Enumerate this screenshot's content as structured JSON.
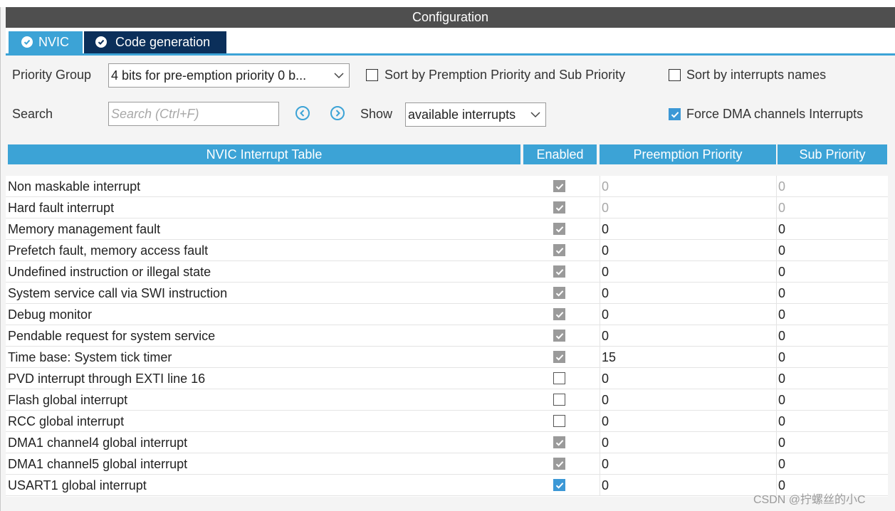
{
  "header": {
    "title": "Configuration"
  },
  "tabs": [
    {
      "label": "NVIC",
      "active": true
    },
    {
      "label": "Code generation",
      "active": false
    }
  ],
  "controls": {
    "priority_group_label": "Priority Group",
    "priority_group_value": "4 bits for pre-emption priority 0 b...",
    "sort_premption_label": "Sort by Premption Priority and Sub Priority",
    "sort_premption_checked": false,
    "sort_names_label": "Sort by interrupts names",
    "sort_names_checked": false,
    "search_label": "Search",
    "search_placeholder": "Search (Ctrl+F)",
    "search_value": "",
    "show_label": "Show",
    "show_value": "available interrupts",
    "force_dma_label": "Force DMA channels Interrupts",
    "force_dma_checked": true
  },
  "table": {
    "headers": [
      "NVIC Interrupt Table",
      "Enabled",
      "Preemption Priority",
      "Sub Priority"
    ],
    "rows": [
      {
        "name": "Non maskable interrupt",
        "enabled": "locked",
        "preemption": "0",
        "sub": "0",
        "editable": false
      },
      {
        "name": "Hard fault interrupt",
        "enabled": "locked",
        "preemption": "0",
        "sub": "0",
        "editable": false
      },
      {
        "name": "Memory management fault",
        "enabled": "locked",
        "preemption": "0",
        "sub": "0",
        "editable": true
      },
      {
        "name": "Prefetch fault, memory access fault",
        "enabled": "locked",
        "preemption": "0",
        "sub": "0",
        "editable": true
      },
      {
        "name": "Undefined instruction or illegal state",
        "enabled": "locked",
        "preemption": "0",
        "sub": "0",
        "editable": true
      },
      {
        "name": "System service call via SWI instruction",
        "enabled": "locked",
        "preemption": "0",
        "sub": "0",
        "editable": true
      },
      {
        "name": "Debug monitor",
        "enabled": "locked",
        "preemption": "0",
        "sub": "0",
        "editable": true
      },
      {
        "name": "Pendable request for system service",
        "enabled": "locked",
        "preemption": "0",
        "sub": "0",
        "editable": true
      },
      {
        "name": "Time base: System tick timer",
        "enabled": "locked",
        "preemption": "15",
        "sub": "0",
        "editable": true
      },
      {
        "name": "PVD interrupt through EXTI line 16",
        "enabled": "off",
        "preemption": "0",
        "sub": "0",
        "editable": true
      },
      {
        "name": "Flash global interrupt",
        "enabled": "off",
        "preemption": "0",
        "sub": "0",
        "editable": true
      },
      {
        "name": "RCC global interrupt",
        "enabled": "off",
        "preemption": "0",
        "sub": "0",
        "editable": true
      },
      {
        "name": "DMA1 channel4 global interrupt",
        "enabled": "locked",
        "preemption": "0",
        "sub": "0",
        "editable": true
      },
      {
        "name": "DMA1 channel5 global interrupt",
        "enabled": "locked",
        "preemption": "0",
        "sub": "0",
        "editable": true
      },
      {
        "name": "USART1 global interrupt",
        "enabled": "on",
        "preemption": "0",
        "sub": "0",
        "editable": true
      }
    ]
  },
  "watermark": "CSDN @拧螺丝的小C",
  "colors": {
    "header_bg": "#4f4f4f",
    "tab_active": "#3ca3d6",
    "tab_inactive": "#0b2f5a",
    "table_header": "#3ca3d6",
    "check_blue": "#3c98d6",
    "check_locked": "#9a9a9a"
  }
}
